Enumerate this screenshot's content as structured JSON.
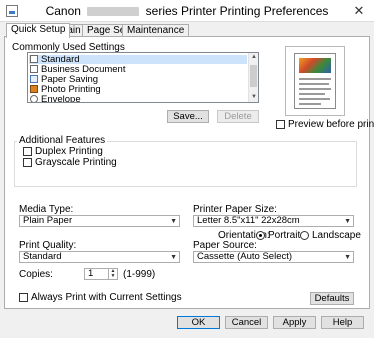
{
  "window": {
    "title_prefix": "Canon",
    "title_suffix": "series Printer Printing Preferences",
    "close_glyph": "✕"
  },
  "tabs": [
    {
      "label": "Quick Setup"
    },
    {
      "label": "Main"
    },
    {
      "label": "Page Setup"
    },
    {
      "label": "Maintenance"
    }
  ],
  "commonly_used": {
    "heading": "Commonly Used Settings",
    "items": [
      {
        "label": "Standard",
        "icon": "printer-icon"
      },
      {
        "label": "Business Document",
        "icon": "document-icon"
      },
      {
        "label": "Paper Saving",
        "icon": "paper-saving-icon"
      },
      {
        "label": "Photo Printing",
        "icon": "photo-icon"
      },
      {
        "label": "Envelope",
        "icon": "envelope-icon"
      }
    ],
    "selected": "Standard",
    "save_label": "Save...",
    "delete_label": "Delete"
  },
  "preview": {
    "checkbox_label": "Preview before printing",
    "checked": false
  },
  "additional_features": {
    "heading": "Additional Features",
    "duplex_label": "Duplex Printing",
    "duplex_checked": false,
    "grayscale_label": "Grayscale Printing",
    "grayscale_checked": false
  },
  "media_type": {
    "label": "Media Type:",
    "value": "Plain Paper"
  },
  "printer_paper_size": {
    "label": "Printer Paper Size:",
    "value": "Letter 8.5\"x11\" 22x28cm"
  },
  "orientation": {
    "label": "Orientation:",
    "portrait_label": "Portrait",
    "landscape_label": "Landscape",
    "selected": "Portrait"
  },
  "print_quality": {
    "label": "Print Quality:",
    "value": "Standard"
  },
  "paper_source": {
    "label": "Paper Source:",
    "value": "Cassette (Auto Select)"
  },
  "copies": {
    "label": "Copies:",
    "value": "1",
    "range": "(1-999)"
  },
  "always_print": {
    "label": "Always Print with Current Settings",
    "checked": false
  },
  "defaults_label": "Defaults",
  "footer": {
    "ok_label": "OK",
    "cancel_label": "Cancel",
    "apply_label": "Apply",
    "help_label": "Help"
  },
  "colors": {
    "accent": "#0078d7",
    "selection": "#cde3fb"
  }
}
